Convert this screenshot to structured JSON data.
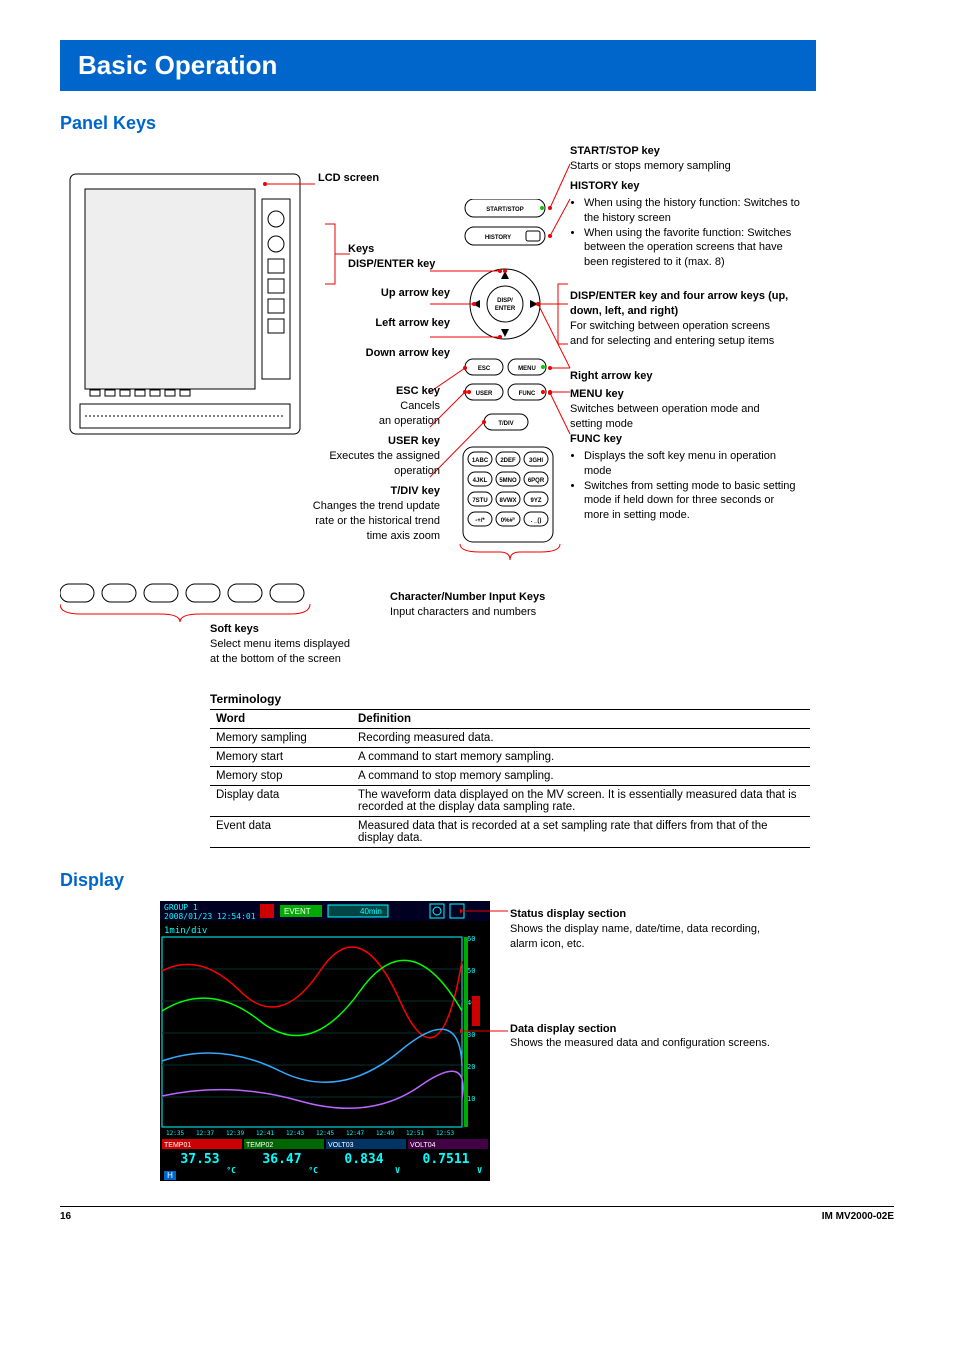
{
  "title": "Basic Operation",
  "section1": "Panel Keys",
  "section2": "Display",
  "lcd_label": "LCD screen",
  "keys_label": "Keys",
  "disp_enter_label": "DISP/ENTER key",
  "up_arrow_label": "Up arrow key",
  "left_arrow_label": "Left arrow key",
  "down_arrow_label": "Down arrow key",
  "esc_key_label": "ESC key",
  "esc_key_sub1": "Cancels",
  "esc_key_sub2": "an operation",
  "user_key_label": "USER key",
  "user_key_sub1": "Executes the assigned",
  "user_key_sub2": "operation",
  "tdiv_label": "T/DIV key",
  "tdiv_sub1": "Changes the trend update",
  "tdiv_sub2": "rate or the historical trend",
  "tdiv_sub3": "time axis zoom",
  "softkeys_label": "Soft keys",
  "softkeys_sub1": "Select menu items displayed",
  "softkeys_sub2": "at the bottom of the screen",
  "charnum_label": "Character/Number Input Keys",
  "charnum_sub": "Input characters and numbers",
  "startstop": {
    "t": "START/STOP key",
    "d": "Starts or stops memory sampling"
  },
  "history": {
    "t": "HISTORY key",
    "d1": "When using the history function: Switches to the history screen",
    "d2": "When using the favorite function: Switches between the operation screens that have been registered to it (max. 8)"
  },
  "dispenter_right": {
    "t": "DISP/ENTER key and four arrow keys (up, down, left, and right)",
    "d": "For switching between operation screens and for selecting and entering setup items"
  },
  "right_arrow_label": "Right arrow key",
  "menu": {
    "t": "MENU key",
    "d": "Switches between operation mode and setting mode"
  },
  "func": {
    "t": "FUNC key",
    "d1": "Displays the soft key menu in operation mode",
    "d2": "Switches from setting mode to basic setting mode if held down for three seconds or more in setting mode."
  },
  "term_title": "Terminology",
  "term_headers": [
    "Word",
    "Definition"
  ],
  "term_rows": [
    [
      "Memory sampling",
      "Recording measured data."
    ],
    [
      "Memory start",
      "A command to start memory sampling."
    ],
    [
      "Memory stop",
      "A command to stop memory sampling."
    ],
    [
      "Display data",
      "The waveform data displayed on the MV screen. It is essentially measured data that is recorded at the display data sampling rate."
    ],
    [
      "Event data",
      "Measured data that is recorded at a set sampling rate that differs from that of the display data."
    ]
  ],
  "status_section": {
    "t": "Status display section",
    "d": "Shows the display name, date/time, data recording, alarm icon, etc."
  },
  "data_section": {
    "t": "Data display section",
    "d": "Shows the measured data and configuration screens."
  },
  "footer_page": "16",
  "footer_doc": "IM MV2000-02E",
  "chart_data": {
    "type": "line",
    "title": "GROUP 1",
    "datetime": "2008/01/23 12:54:01",
    "timebase": "1min/div",
    "event_tag": "EVENT",
    "duration_tag": "40min",
    "ylim": [
      0,
      60
    ],
    "yticks": [
      10,
      20,
      30,
      40,
      50,
      60
    ],
    "xticks": [
      "12:35",
      "12:37",
      "12:39",
      "12:41",
      "12:43",
      "12:45",
      "12:47",
      "12:49",
      "12:51",
      "12:53"
    ],
    "series": [
      {
        "name": "TEMP01",
        "value": 37.53,
        "unit": "°C",
        "color": "#ff0000"
      },
      {
        "name": "TEMP02",
        "value": 36.47,
        "unit": "°C",
        "color": "#00ff00"
      },
      {
        "name": "VOLT03",
        "value": 0.834,
        "unit": "V",
        "color": "#00a0ff"
      },
      {
        "name": "VOLT04",
        "value": 0.7511,
        "unit": "V",
        "color": "#a040ff"
      }
    ],
    "h_indicator": "H"
  }
}
